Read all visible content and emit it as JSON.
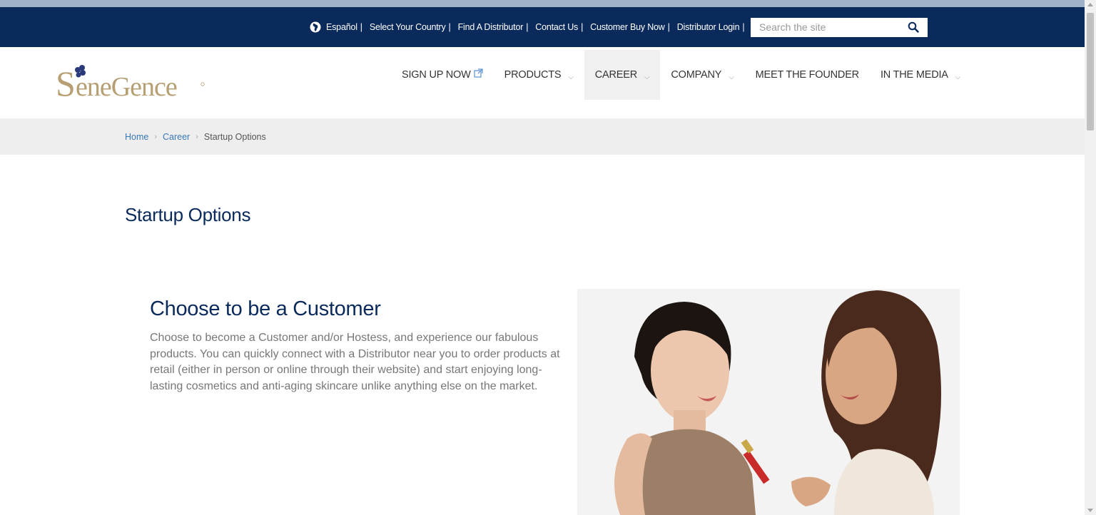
{
  "utility_bar": {
    "links": [
      "Español",
      "Select Your Country",
      "Find A Distributor",
      "Contact Us",
      "Customer Buy Now",
      "Distributor Login"
    ],
    "separator": "|",
    "search_placeholder": "Search the site"
  },
  "header": {
    "logo_text": "SeneGence",
    "nav": [
      {
        "label": "SIGN UP NOW",
        "icon": "external-link-icon"
      },
      {
        "label": "PRODUCTS",
        "chevron": "⌵"
      },
      {
        "label": "CAREER",
        "chevron": "⌵"
      },
      {
        "label": "COMPANY",
        "chevron": "⌵"
      },
      {
        "label": "MEET THE FOUNDER"
      },
      {
        "label": "IN THE MEDIA",
        "chevron": "⌵"
      }
    ]
  },
  "breadcrumb": {
    "items": [
      "Home",
      "Career"
    ],
    "current": "Startup Options",
    "arrow": "›"
  },
  "main": {
    "page_title": "Startup Options",
    "section_title": "Choose to be a Customer",
    "section_body": "Choose to become a Customer and/or Hostess, and experience our fabulous products. You can quickly connect with a Distributor near you to order products at retail (either in person or online through their website) and start enjoying long-lasting cosmetics and anti-aging skincare unlike anything else on the market."
  },
  "colors": {
    "navy": "#0a2a5c",
    "link_blue": "#3a78b5",
    "logo_gold": "#b79f74"
  }
}
